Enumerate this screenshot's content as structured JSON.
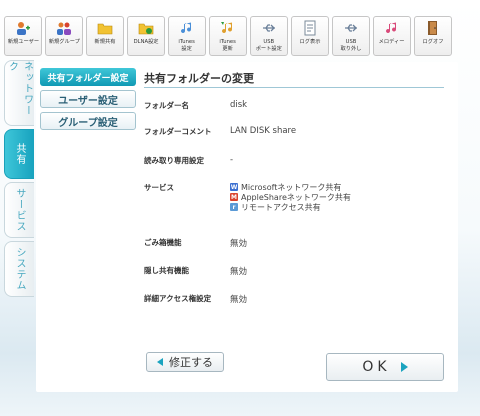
{
  "toolbar": [
    {
      "label": "新規ユーザー",
      "icon": "new-user-icon"
    },
    {
      "label": "新規グループ",
      "icon": "new-group-icon"
    },
    {
      "label": "新規共有",
      "icon": "new-share-folder-icon"
    },
    {
      "label": "DLNA設定",
      "icon": "dlna-settings-icon"
    },
    {
      "label": "iTunes\n設定",
      "icon": "itunes-settings-icon"
    },
    {
      "label": "iTunes\n更新",
      "icon": "itunes-update-icon"
    },
    {
      "label": "USB\nポート設定",
      "icon": "usb-port-icon"
    },
    {
      "label": "ログ表示",
      "icon": "log-view-icon"
    },
    {
      "label": "USB\n取り外し",
      "icon": "usb-remove-icon"
    },
    {
      "label": "メロディー",
      "icon": "melody-icon"
    },
    {
      "label": "ログオフ",
      "icon": "logoff-icon"
    }
  ],
  "tabs": [
    {
      "label": "ネットワーク",
      "active": false
    },
    {
      "label": "共有",
      "active": true
    },
    {
      "label": "サービス",
      "active": false
    },
    {
      "label": "システム",
      "active": false
    }
  ],
  "subnav": [
    {
      "label": "共有フォルダー設定",
      "active": true
    },
    {
      "label": "ユーザー設定",
      "active": false
    },
    {
      "label": "グループ設定",
      "active": false
    }
  ],
  "title": "共有フォルダーの変更",
  "fields": {
    "folder_name": {
      "label": "フォルダー名",
      "value": "disk"
    },
    "folder_comment": {
      "label": "フォルダーコメント",
      "value": "LAN DISK share"
    },
    "readonly": {
      "label": "読み取り専用設定",
      "value": "-"
    },
    "service": {
      "label": "サービス",
      "items": [
        {
          "badge": "W",
          "color": "#3b6fd0",
          "text": "Microsoftネットワーク共有"
        },
        {
          "badge": "M",
          "color": "#d9432e",
          "text": "AppleShareネットワーク共有"
        },
        {
          "badge": "r",
          "color": "#5b9ad6",
          "text": "リモートアクセス共有"
        }
      ]
    },
    "trash": {
      "label": "ごみ箱機能",
      "value": "無効"
    },
    "hidden": {
      "label": "隠し共有機能",
      "value": "無効"
    },
    "acl": {
      "label": "詳細アクセス権設定",
      "value": "無効"
    }
  },
  "buttons": {
    "edit": "修正する",
    "ok": "OK"
  },
  "colors": {
    "accent": "#1aa3bf"
  }
}
